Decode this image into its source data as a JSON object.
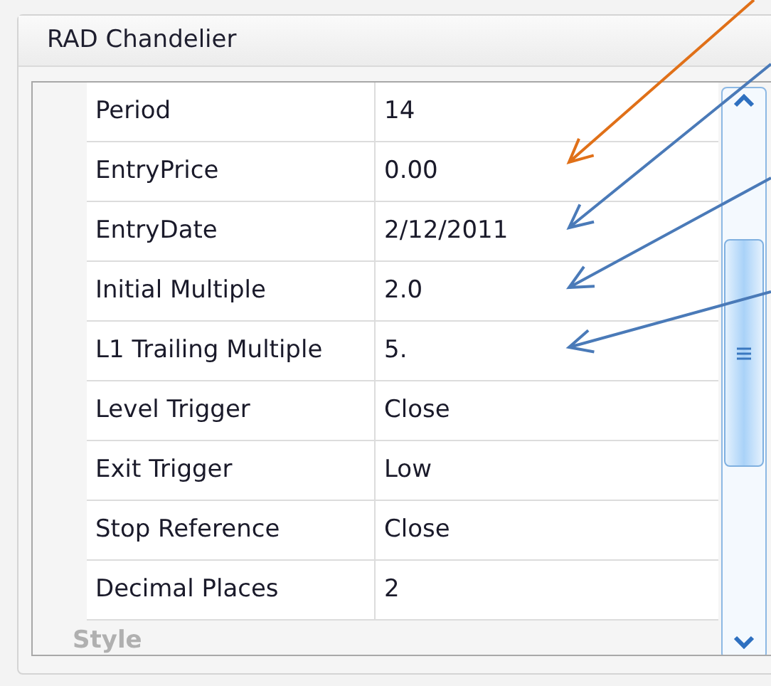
{
  "panel": {
    "title": "RAD Chandelier"
  },
  "properties": [
    {
      "name": "Period",
      "value": "14"
    },
    {
      "name": "EntryPrice",
      "value": "0.00"
    },
    {
      "name": "EntryDate",
      "value": "2/12/2011"
    },
    {
      "name": "Initial Multiple",
      "value": "2.0"
    },
    {
      "name": "L1 Trailing Multiple",
      "value": "5."
    },
    {
      "name": "Level Trigger",
      "value": "Close"
    },
    {
      "name": "Exit Trigger",
      "value": "Low"
    },
    {
      "name": "Stop Reference",
      "value": "Close"
    },
    {
      "name": "Decimal Places",
      "value": "2"
    }
  ],
  "next_category": "Style",
  "annotation_arrows": [
    {
      "color": "#e07018"
    },
    {
      "color": "#4a7ab8"
    },
    {
      "color": "#4a7ab8"
    },
    {
      "color": "#4a7ab8"
    }
  ]
}
